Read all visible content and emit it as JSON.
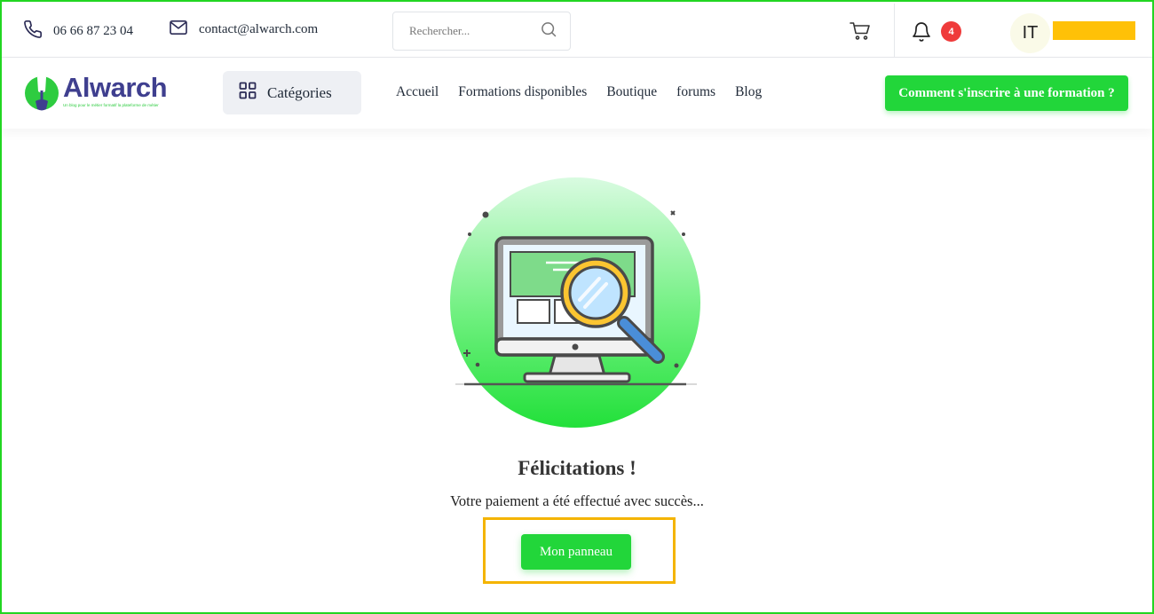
{
  "topbar": {
    "phone": "06 66 87 23 04",
    "email": "contact@alwarch.com",
    "search_placeholder": "Rechercher...",
    "notification_count": "4",
    "avatar_initials": "IT"
  },
  "navbar": {
    "logo_name": "Alwarch",
    "logo_tagline": "Un blog pour le métier formatif la plateforme de métier",
    "categories_label": "Catégories",
    "menu": [
      "Accueil",
      "Formations disponibles",
      "Boutique",
      "forums",
      "Blog"
    ],
    "cta_label": "Comment s'inscrire à une formation ?"
  },
  "main": {
    "title": "Félicitations !",
    "message": "Votre paiement a été effectué avec succès...",
    "button_label": "Mon panneau"
  },
  "colors": {
    "accent_green": "#22d63a",
    "badge_red": "#ef3b3b",
    "highlight_yellow": "#f4b400",
    "logo_blue": "#3f3f8f"
  },
  "icons": [
    "phone-icon",
    "mail-icon",
    "search-icon",
    "cart-icon",
    "bell-icon",
    "grid-icon",
    "shovel-logo-icon",
    "computer-magnifier-illustration"
  ]
}
